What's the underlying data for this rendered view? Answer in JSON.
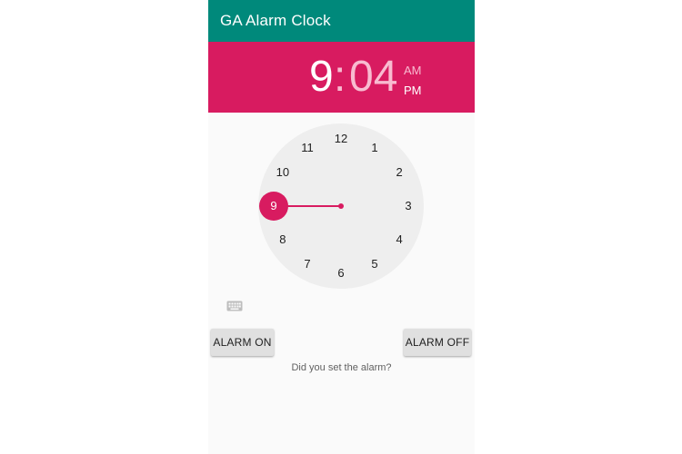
{
  "app_bar": {
    "title": "GA Alarm Clock",
    "color": "#00897b"
  },
  "time_picker": {
    "header_color": "#d81b60",
    "hour": "9",
    "separator": ":",
    "minute": "04",
    "am_label": "AM",
    "pm_label": "PM",
    "selected_period": "PM",
    "selected_hour": "9",
    "dial_numbers": [
      "12",
      "1",
      "2",
      "3",
      "4",
      "5",
      "6",
      "7",
      "8",
      "9",
      "10",
      "11"
    ],
    "keyboard_toggle_icon": "keyboard-icon"
  },
  "actions": {
    "alarm_on_label": "ALARM ON",
    "alarm_off_label": "ALARM OFF"
  },
  "status": {
    "message": "Did you set the alarm?"
  }
}
